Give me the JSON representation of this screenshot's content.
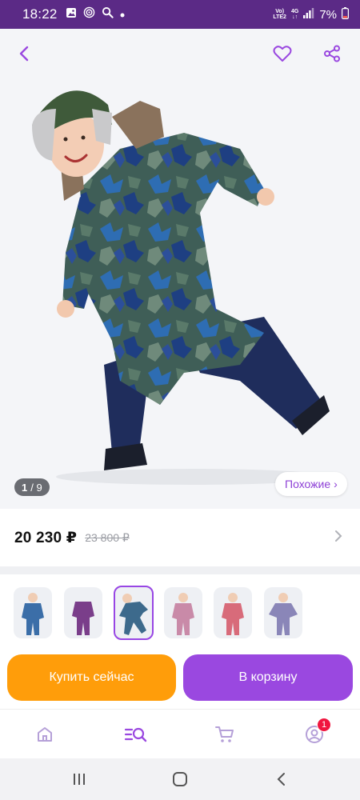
{
  "status_bar": {
    "time": "18:22",
    "network_top": "Vo)",
    "network_bottom": "LTE2",
    "signal_type_top": "4G",
    "battery_percent": "7%"
  },
  "product": {
    "image_counter": {
      "current": "1",
      "total": "/ 9"
    },
    "similar_label": "Похожие",
    "price": "20 230 ₽",
    "old_price": "23 800 ₽"
  },
  "variants": [
    {
      "name": "blue-print-overall",
      "color": "#3b6ea8",
      "selected": false
    },
    {
      "name": "purple-overall",
      "color": "#7a3e8a",
      "selected": false
    },
    {
      "name": "blue-camo-overall",
      "color": "#3d6a8c",
      "selected": true
    },
    {
      "name": "pink-print-overall",
      "color": "#c98aa8",
      "selected": false
    },
    {
      "name": "pink-red-overall",
      "color": "#d86b7a",
      "selected": false
    },
    {
      "name": "lilac-print-overall",
      "color": "#8a86b8",
      "selected": false
    }
  ],
  "actions": {
    "buy_now": "Купить сейчас",
    "add_to_cart": "В корзину"
  },
  "bottom_nav": {
    "profile_badge": "1"
  },
  "colors": {
    "brand_purple": "#9a48e0",
    "accent_orange": "#ff9d0a",
    "status_bar": "#5b2a86",
    "badge_red": "#f0163f"
  }
}
